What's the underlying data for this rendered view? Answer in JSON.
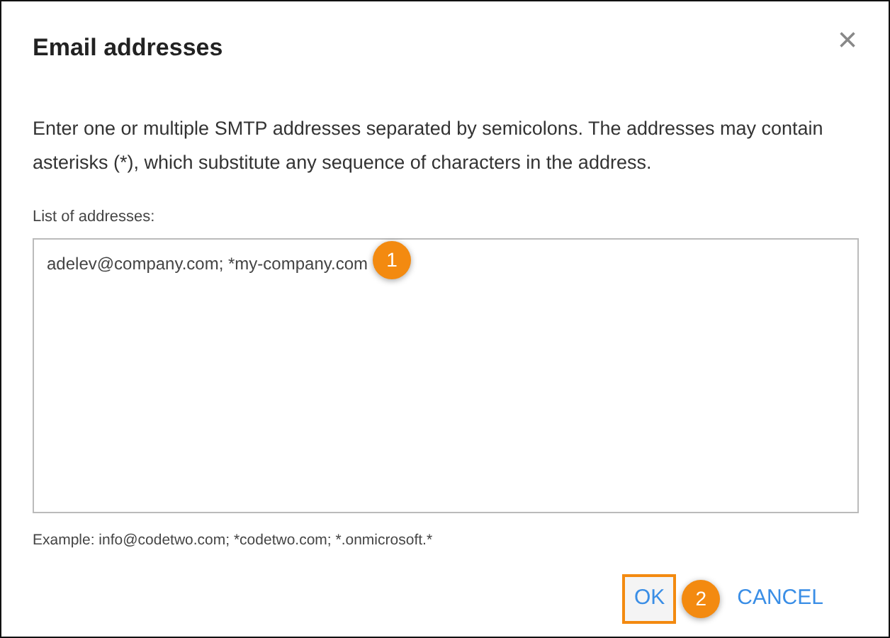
{
  "dialog": {
    "title": "Email addresses",
    "close": "×",
    "description": "Enter one or multiple SMTP addresses separated by semicolons. The addresses may contain asterisks (*), which substitute any sequence of characters in the address.",
    "field": {
      "label": "List of addresses:",
      "value": "adelev@company.com; *my-company.com",
      "callout": "1"
    },
    "example": "Example: info@codetwo.com; *codetwo.com; *.onmicrosoft.*",
    "buttons": [
      {
        "label": "OK",
        "highlighted": true,
        "callout": "2"
      },
      {
        "label": "CANCEL",
        "highlighted": false
      }
    ]
  }
}
